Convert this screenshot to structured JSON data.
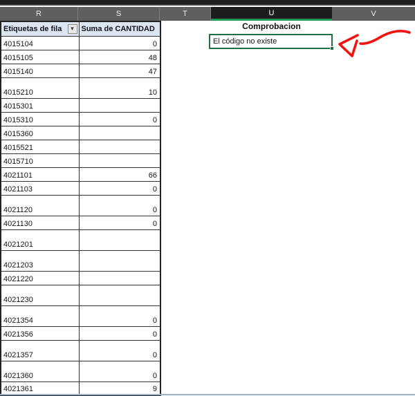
{
  "columns": [
    {
      "letter": "R",
      "selected": false
    },
    {
      "letter": "S",
      "selected": false
    },
    {
      "letter": "T",
      "selected": false
    },
    {
      "letter": "U",
      "selected": true
    },
    {
      "letter": "V",
      "selected": false
    }
  ],
  "pivot": {
    "row_labels_header": "Etiquetas de fila",
    "values_header": "Suma de CANTIDAD",
    "filter_icon": "▼",
    "rows": [
      {
        "label": "4015104",
        "value": "0",
        "tall": false
      },
      {
        "label": "4015105",
        "value": "48",
        "tall": false
      },
      {
        "label": "4015140",
        "value": "47",
        "tall": false
      },
      {
        "label": "4015210",
        "value": "10",
        "tall": true
      },
      {
        "label": "4015301",
        "value": "",
        "tall": false
      },
      {
        "label": "4015310",
        "value": "0",
        "tall": false
      },
      {
        "label": "4015360",
        "value": "",
        "tall": false
      },
      {
        "label": "4015521",
        "value": "",
        "tall": false
      },
      {
        "label": "4015710",
        "value": "",
        "tall": false
      },
      {
        "label": "4021101",
        "value": "66",
        "tall": false
      },
      {
        "label": "4021103",
        "value": "0",
        "tall": false
      },
      {
        "label": "4021120",
        "value": "0",
        "tall": true
      },
      {
        "label": "4021130",
        "value": "0",
        "tall": false
      },
      {
        "label": "4021201",
        "value": "",
        "tall": true
      },
      {
        "label": "4021203",
        "value": "",
        "tall": true
      },
      {
        "label": "4021220",
        "value": "",
        "tall": false
      },
      {
        "label": "4021230",
        "value": "",
        "tall": true
      },
      {
        "label": "4021354",
        "value": "0",
        "tall": true
      },
      {
        "label": "4021356",
        "value": "0",
        "tall": false
      },
      {
        "label": "4021357",
        "value": "0",
        "tall": true
      },
      {
        "label": "4021360",
        "value": "0",
        "tall": true
      },
      {
        "label": "4021361",
        "value": "9",
        "tall": false
      }
    ]
  },
  "comprobacion": {
    "title": "Comprobacion",
    "cell_text": "El código no existe"
  },
  "colors": {
    "excel_selection_green": "#1F7145",
    "column_underline_green": "#1c9c54",
    "band_gray": "#5f5f5f",
    "selected_column_bg": "#1c1c1c",
    "pivot_header_fill": "#DCE6F1",
    "arrow_red": "#F2120F"
  }
}
